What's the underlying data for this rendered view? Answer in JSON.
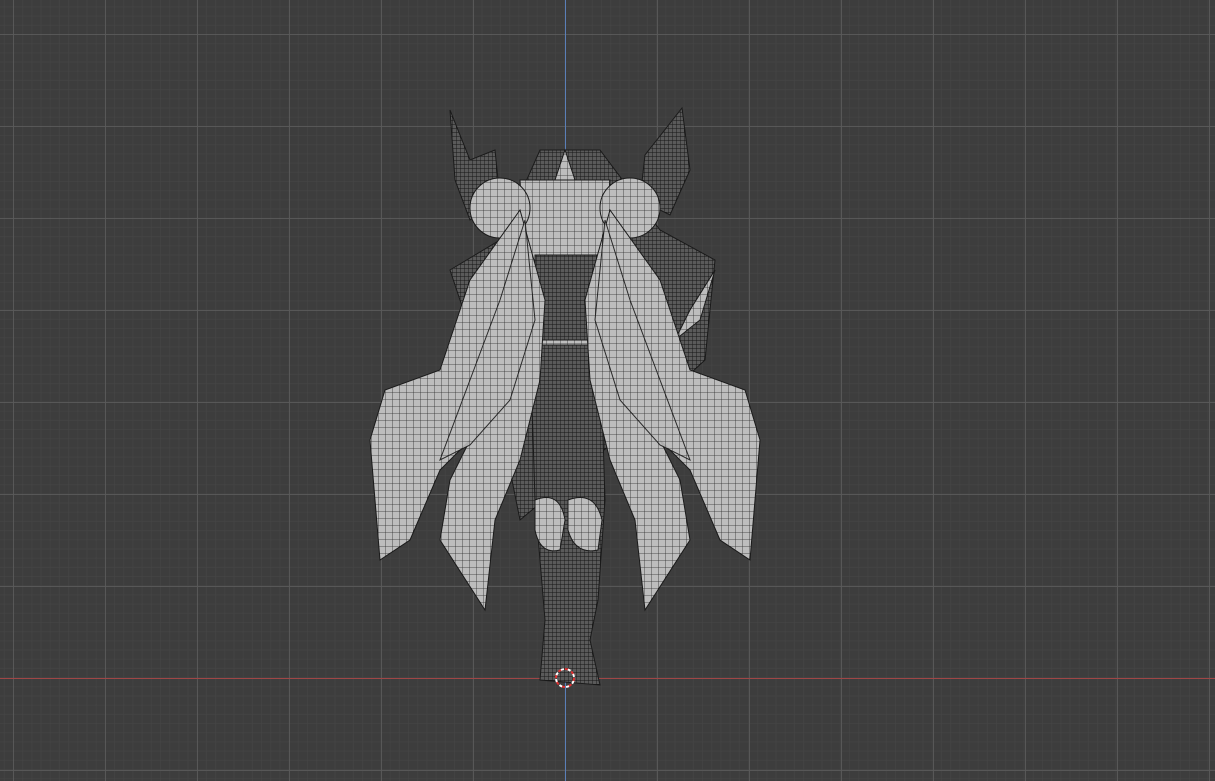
{
  "viewport": {
    "mode": "front-orthographic",
    "background": "#3d3d3d"
  },
  "colors": {
    "x_axis": "#a04646",
    "z_axis": "#5a7fb8",
    "mesh_fill": "#b9b9b9",
    "wire": "#2a2a2a",
    "cursor_red": "#e03030"
  },
  "object": {
    "icon": "mesh-object",
    "cursor_icon": "3d-cursor-icon"
  }
}
